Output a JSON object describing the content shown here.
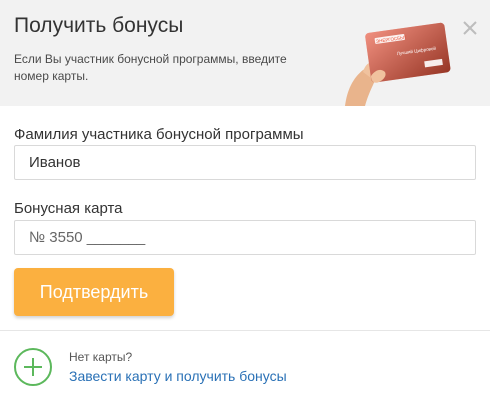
{
  "header": {
    "title": "Получить бонусы",
    "subtitle": "Если Вы участник бонусной программы, введите номер карты.",
    "close_icon": "close-icon"
  },
  "card_art": {
    "brand_text": "ЭНЕРГОСБЫТ",
    "card_text": "Лучший Цифровой",
    "icon": "hand-holding-card-image"
  },
  "form": {
    "surname_label": "Фамилия участника бонусной программы",
    "surname_value": "Иванов",
    "card_label": "Бонусная карта",
    "card_placeholder": "№ 3550 _______",
    "submit_label": "Подтвердить"
  },
  "footer": {
    "no_card_text": "Нет карты?",
    "get_card_link": "Завести карту и получить бонусы",
    "plus_icon": "plus-circle-icon"
  },
  "colors": {
    "accent": "#fbb040",
    "link": "#2a71b6",
    "plus": "#5cb85c",
    "header_bg": "#f2f2f2",
    "card": "#e8533a"
  }
}
